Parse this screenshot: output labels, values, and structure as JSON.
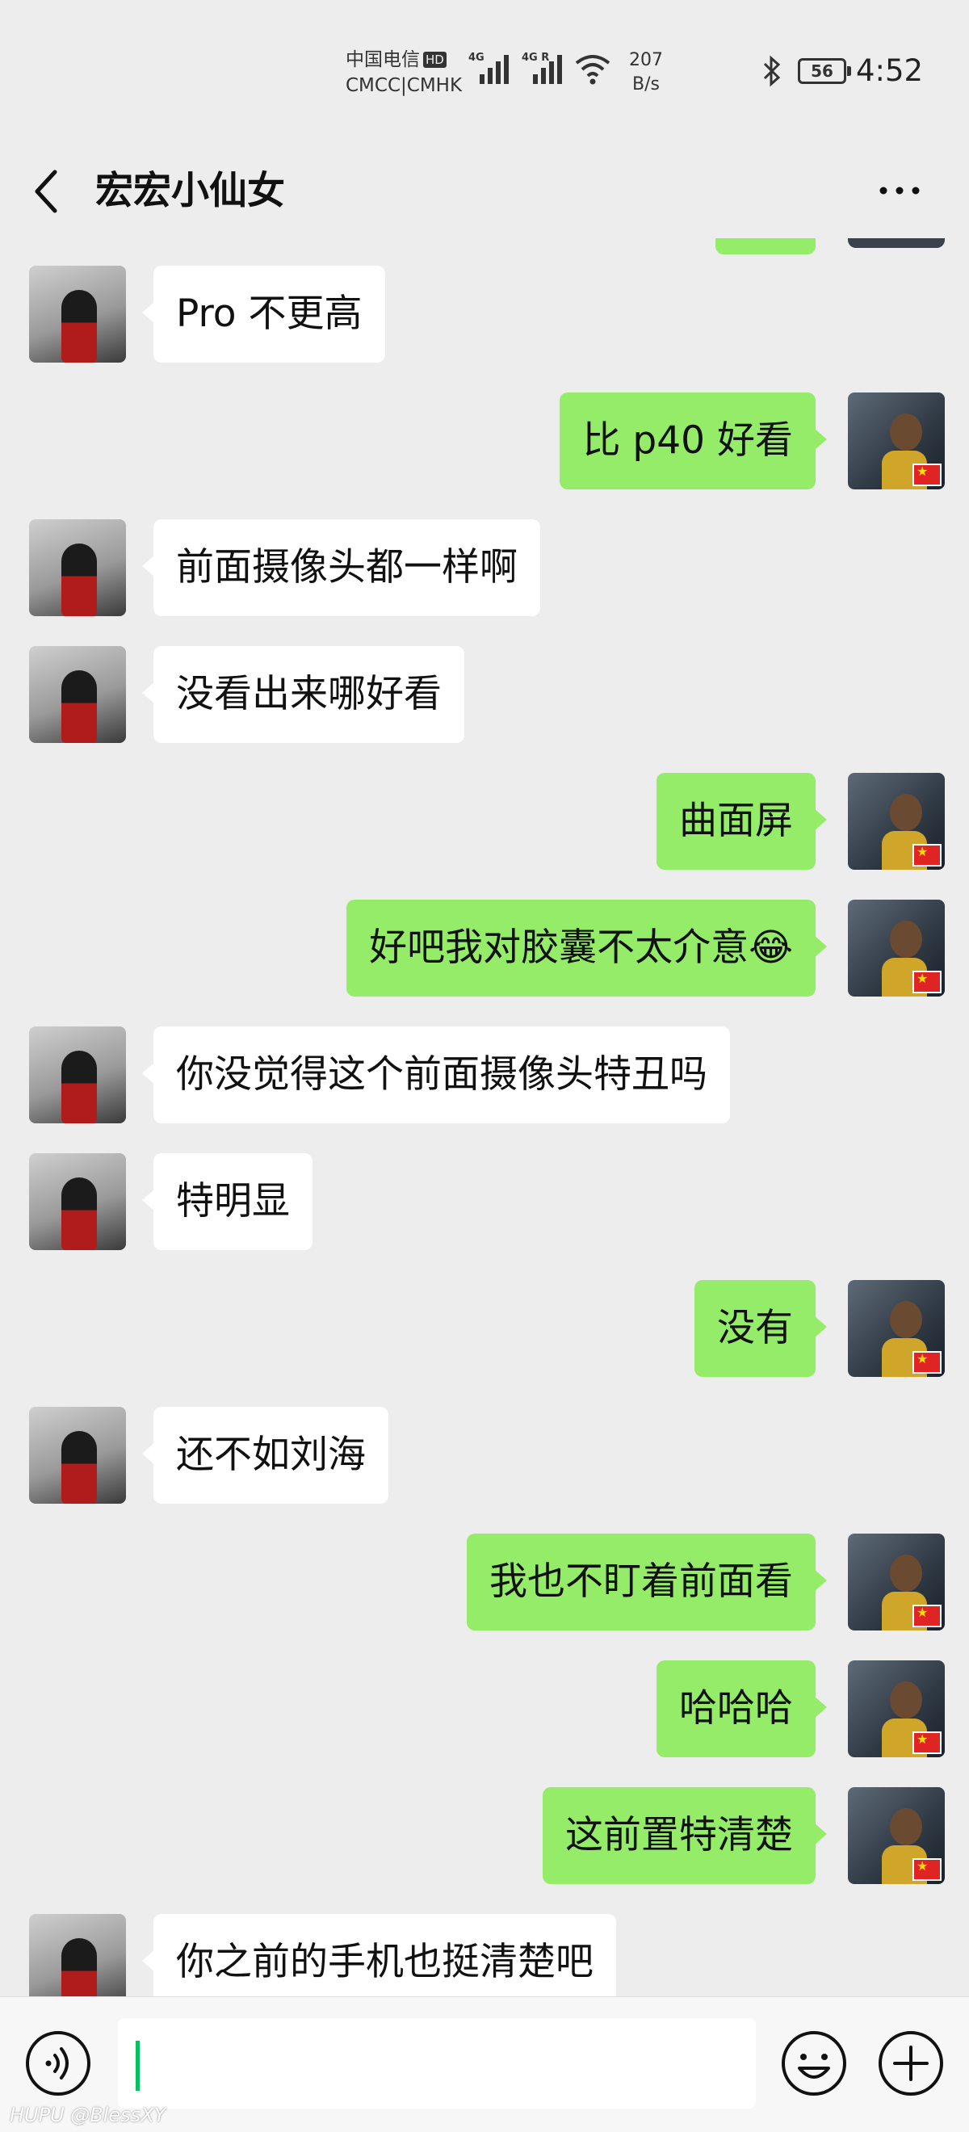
{
  "status_bar": {
    "carrier_line1": "中国电信",
    "hd_badge": "HD",
    "carrier_line2": "CMCC|CMHK",
    "signal1_tag": "4G",
    "signal2_tag": "4G R",
    "net_speed_value": "207",
    "net_speed_unit": "B/s",
    "battery_level": "56",
    "time": "4:52"
  },
  "header": {
    "title": "宏宏小仙女"
  },
  "messages": [
    {
      "side": "left",
      "text": "Pro 不更高"
    },
    {
      "side": "right",
      "text": "比 p40 好看"
    },
    {
      "side": "left",
      "text": "前面摄像头都一样啊"
    },
    {
      "side": "left",
      "text": "没看出来哪好看"
    },
    {
      "side": "right",
      "text": "曲面屏"
    },
    {
      "side": "right",
      "text": "好吧我对胶囊不太介意😂"
    },
    {
      "side": "left",
      "text": "你没觉得这个前面摄像头特丑吗"
    },
    {
      "side": "left",
      "text": "特明显"
    },
    {
      "side": "right",
      "text": "没有"
    },
    {
      "side": "left",
      "text": "还不如刘海"
    },
    {
      "side": "right",
      "text": "我也不盯着前面看"
    },
    {
      "side": "right",
      "text": "哈哈哈"
    },
    {
      "side": "right",
      "text": "这前置特清楚"
    },
    {
      "side": "left",
      "text": "你之前的手机也挺清楚吧"
    }
  ],
  "input_bar": {
    "text_value": ""
  },
  "watermark": "HUPU @BlessXY",
  "colors": {
    "background": "#ededed",
    "outgoing_bubble": "#95ec69",
    "incoming_bubble": "#ffffff",
    "caret": "#07c160"
  }
}
